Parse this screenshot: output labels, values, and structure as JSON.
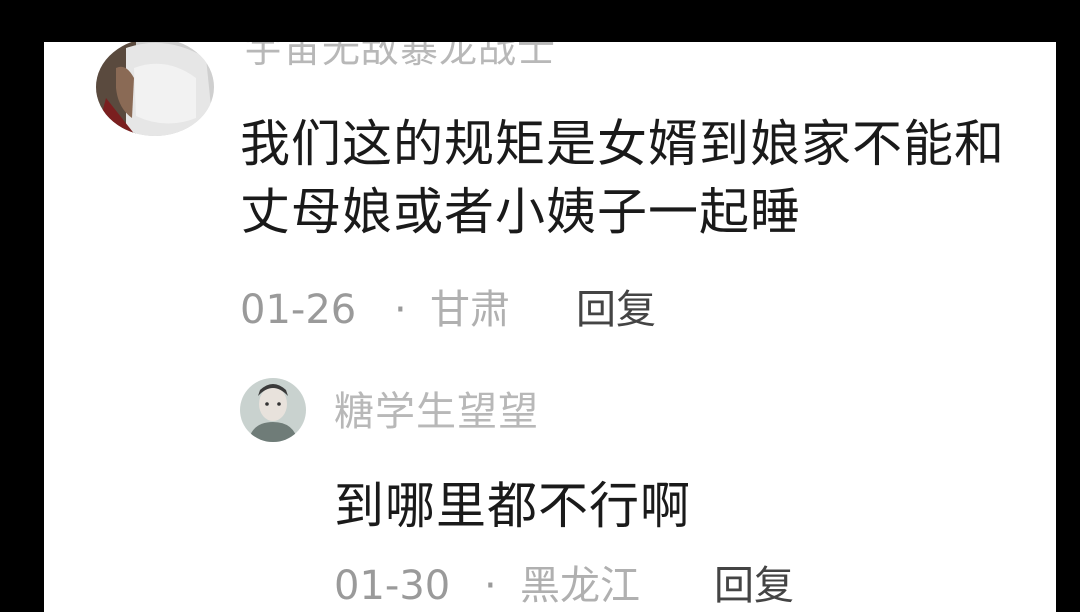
{
  "comments": [
    {
      "username": "宇宙无敌暴龙战士",
      "text": "我们这的规矩是女婿到娘家不能和丈母娘或者小姨子一起睡",
      "date": "01-26",
      "separator": "·",
      "location": "甘肃",
      "reply_label": "回复",
      "avatar_icon": "masked-person-avatar-icon"
    },
    {
      "username": "糖学生望望",
      "text": "到哪里都不行啊",
      "date": "01-30",
      "separator": "·",
      "location": "黑龙江",
      "reply_label": "回复",
      "avatar_icon": "person-portrait-avatar-icon"
    }
  ],
  "colors": {
    "background": "#000000",
    "panel": "#ffffff",
    "username": "#b8b8b8",
    "text": "#1a1a1a",
    "meta": "#9a9a9a",
    "reply": "#444444"
  }
}
